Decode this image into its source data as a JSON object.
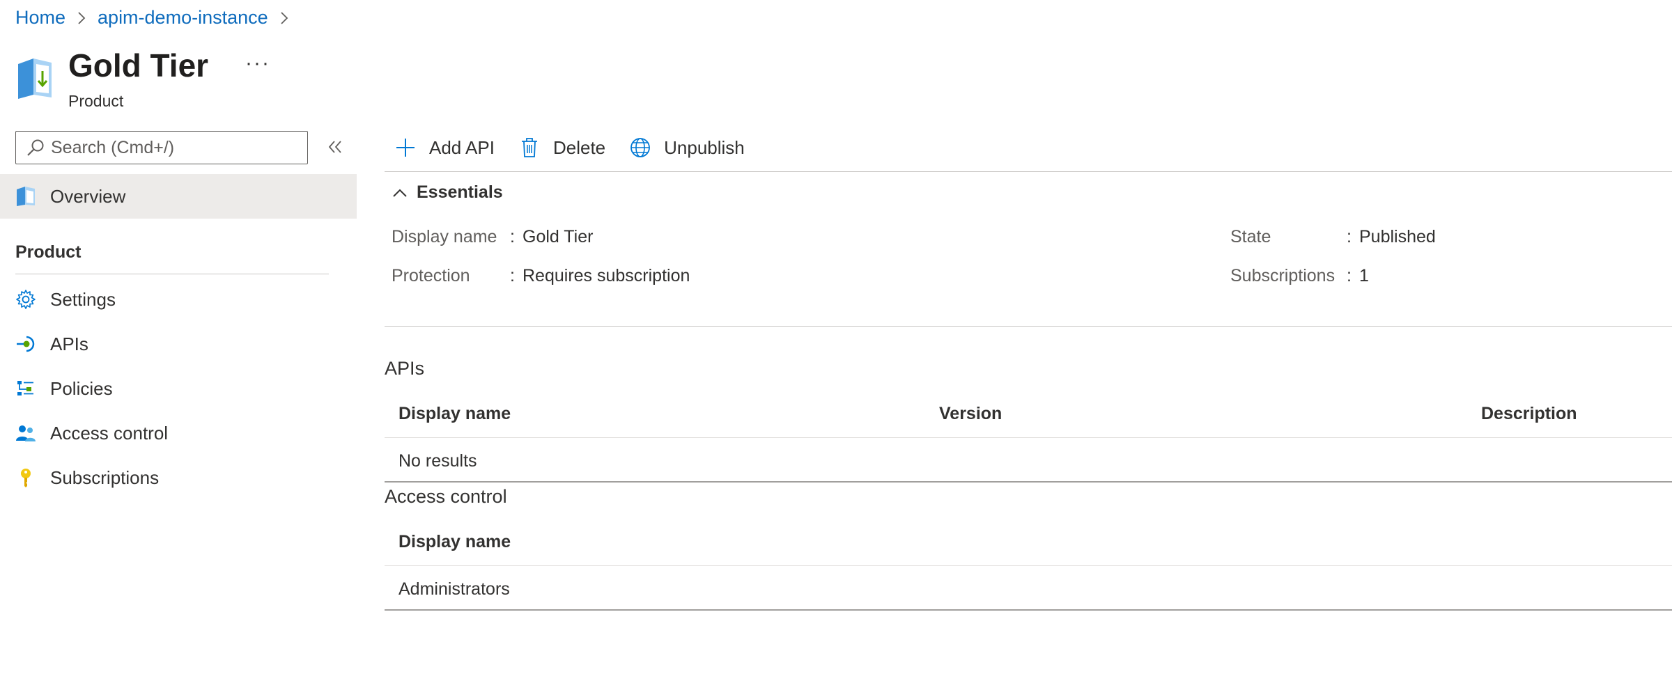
{
  "breadcrumb": [
    {
      "label": "Home"
    },
    {
      "label": "apim-demo-instance"
    }
  ],
  "header": {
    "title": "Gold Tier",
    "subtitle": "Product",
    "more": "···"
  },
  "search": {
    "placeholder": "Search (Cmd+/)"
  },
  "sidebar": {
    "overview": {
      "label": "Overview",
      "icon": "product-icon"
    },
    "group_label": "Product",
    "items": [
      {
        "label": "Settings",
        "icon": "gear-icon"
      },
      {
        "label": "APIs",
        "icon": "api-icon"
      },
      {
        "label": "Policies",
        "icon": "policies-icon"
      },
      {
        "label": "Access control",
        "icon": "people-icon"
      },
      {
        "label": "Subscriptions",
        "icon": "key-icon"
      }
    ]
  },
  "toolbar": {
    "add_api": "Add API",
    "delete": "Delete",
    "unpublish": "Unpublish"
  },
  "essentials": {
    "title": "Essentials",
    "separator": ":",
    "display_name": {
      "label": "Display name",
      "value": "Gold Tier"
    },
    "protection": {
      "label": "Protection",
      "value": "Requires subscription"
    },
    "state": {
      "label": "State",
      "value": "Published"
    },
    "subscriptions": {
      "label": "Subscriptions",
      "value": "1"
    }
  },
  "apis": {
    "title": "APIs",
    "columns": [
      "Display name",
      "Version",
      "Description"
    ],
    "empty_text": "No results"
  },
  "access_control": {
    "title": "Access control",
    "columns": [
      "Display name"
    ],
    "rows": [
      "Administrators"
    ]
  },
  "colors": {
    "link": "#0f6cbd",
    "selected_bg": "#edebe9",
    "text": "#323130",
    "muted": "#605e5c"
  }
}
